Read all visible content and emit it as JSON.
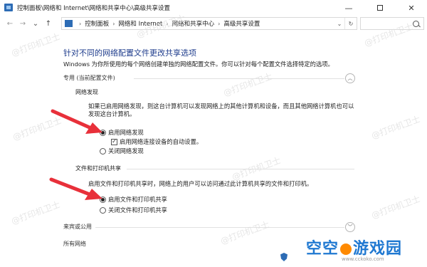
{
  "window": {
    "title": "控制面板\\网络和 Internet\\网络和共享中心\\高级共享设置",
    "minimize_glyph": "—",
    "maximize_glyph": "",
    "close_glyph": "✕"
  },
  "nav": {
    "back_glyph": "←",
    "forward_glyph": "→",
    "dropdown_glyph": "⌄",
    "up_glyph": "↑",
    "breadcrumbs": [
      "控制面板",
      "网络和 Internet",
      "网络和共享中心",
      "高级共享设置"
    ],
    "separator": "›",
    "address_dropdown_glyph": "⌄",
    "refresh_glyph": "↻"
  },
  "main": {
    "heading": "针对不同的网络配置文件更改共享选项",
    "description": "Windows 为你所使用的每个网络创建单独的网络配置文件。你可以针对每个配置文件选择特定的选项。",
    "profile_private": {
      "label": "专用 (当前配置文件)",
      "discovery": {
        "title": "网络发现",
        "text": "如果已启用网络发现，则这台计算机可以发现网络上的其他计算机和设备，而且其他网络计算机也可以发现这台计算机。",
        "option_on": "启用网络发现",
        "auto_setup": "启用网络连接设备的自动设置。",
        "option_off": "关闭网络发现"
      },
      "sharing": {
        "title": "文件和打印机共享",
        "text": "启用文件和打印机共享时，网络上的用户可以访问通过此计算机共享的文件和打印机。",
        "option_on": "启用文件和打印机共享",
        "option_off": "关闭文件和打印机共享"
      }
    },
    "profile_guest": {
      "label": "来宾或公用"
    },
    "profile_all": {
      "label": "所有网络"
    }
  },
  "state": {
    "discovery_selected": "on",
    "auto_setup_checked": true,
    "sharing_selected": "on"
  },
  "watermark_text": "@打印机卫士",
  "logo": {
    "text_left": "空空",
    "text_right": "游戏园",
    "url": "www.cckoko.com"
  },
  "colors": {
    "heading": "#1e3c8c",
    "annotation_arrow": "#e8303a",
    "logo_blue": "#1f78d1",
    "logo_orange": "#ff8a00"
  }
}
